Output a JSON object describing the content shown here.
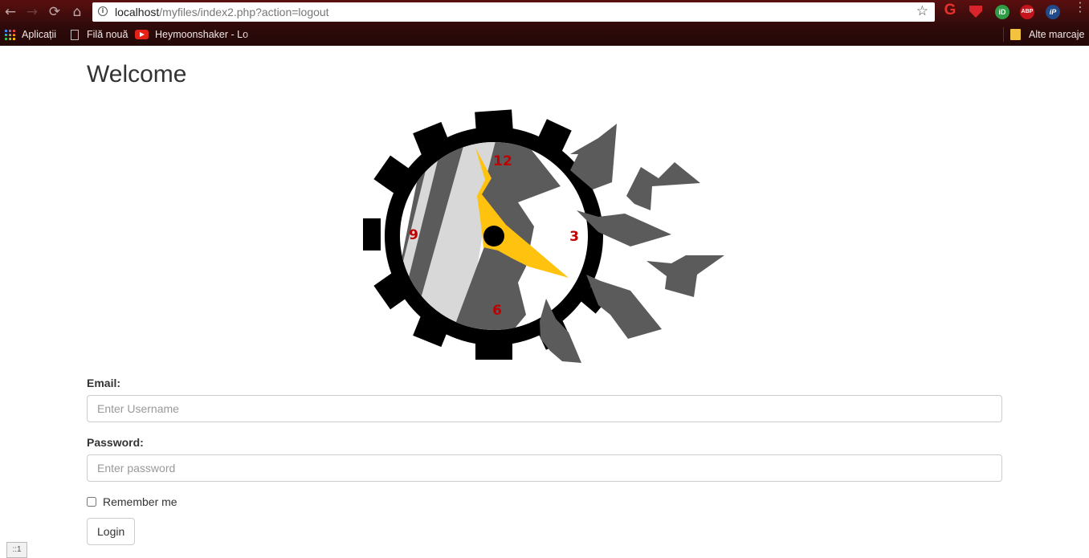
{
  "browser": {
    "url_host": "localhost",
    "url_path": "/myfiles/index2.php?action=logout",
    "nav": {
      "back": "←",
      "forward": "→",
      "reload": "⟳",
      "home": "⌂"
    },
    "star": "☆",
    "extensions": {
      "grammarly": "G",
      "shield": "",
      "id": "iD",
      "abp": "ABP",
      "ip": "iP"
    },
    "menu": "⋮"
  },
  "bookmarks": {
    "apps_label": "Aplicații",
    "new_tab_label": "Filă nouă",
    "youtube_label": "Heymoonshaker - Lo",
    "other_label": "Alte marcaje"
  },
  "page": {
    "title": "Welcome",
    "clock": {
      "numbers": [
        "12",
        "3",
        "6",
        "9"
      ]
    },
    "email_label": "Email:",
    "email_placeholder": "Enter Username",
    "password_label": "Password:",
    "password_placeholder": "Enter password",
    "remember_label": "Remember me",
    "login_button": "Login"
  },
  "debug": {
    "tag": "::1"
  },
  "colors": {
    "chrome_dark": "#2e0a0a",
    "gear": "#000000",
    "shard": "#5b5b5b",
    "hands": "#ffc20e",
    "numbers": "#c00000"
  }
}
